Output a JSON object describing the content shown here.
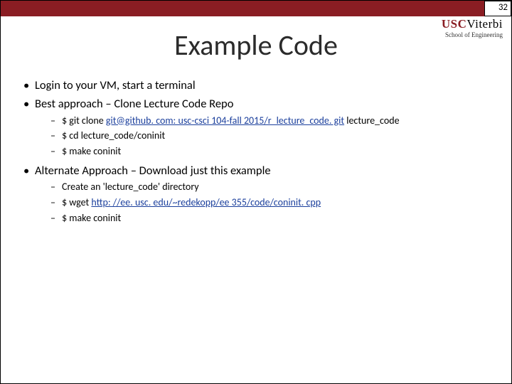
{
  "page_number": "32",
  "logo": {
    "usc": "USC",
    "viterbi": "Viterbi",
    "sub": "School of Engineering"
  },
  "title": "Example Code",
  "body": {
    "b1": "Login to your VM, start a terminal",
    "b2": "Best approach – Clone Lecture Code Repo",
    "b2s1_pre": "$ git clone ",
    "b2s1_link": "git@github. com: usc-csci 104-fall 2015/r_lecture_code. git",
    "b2s1_post": "  lecture_code",
    "b2s2": "$ cd lecture_code/coninit",
    "b2s3": "$ make coninit",
    "b3": "Alternate Approach – Download just this example",
    "b3s1": "Create an 'lecture_code' directory",
    "b3s2_pre": "$ wget ",
    "b3s2_link": "http: //ee. usc. edu/~redekopp/ee 355/code/coninit. cpp",
    "b3s3": "$ make coninit"
  }
}
